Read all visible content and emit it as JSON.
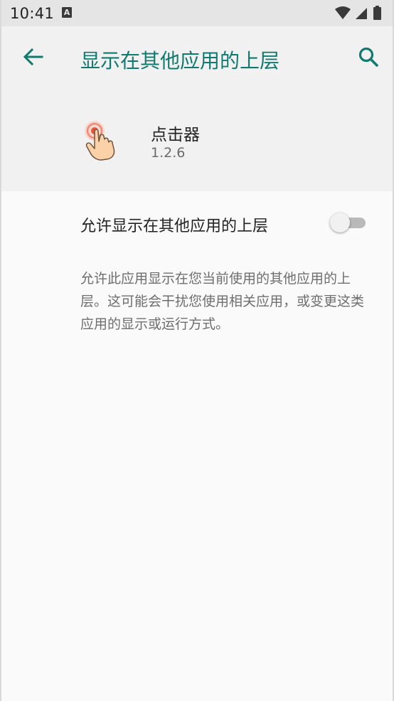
{
  "status_bar": {
    "time": "10:41",
    "notification_icon": "A",
    "icons": [
      "wifi-icon",
      "signal-icon",
      "battery-icon"
    ]
  },
  "header": {
    "title": "显示在其他应用的上层",
    "back_icon": "arrow-left-icon",
    "search_icon": "search-icon"
  },
  "app": {
    "name": "点击器",
    "version": "1.2.6",
    "icon": "tap-hand-icon"
  },
  "setting": {
    "label": "允许显示在其他应用的上层",
    "enabled": false
  },
  "description": "允许此应用显示在您当前使用的其他应用的上层。这可能会干扰您使用相关应用，或变更这类应用的显示或运行方式。",
  "colors": {
    "accent": "#117a6e",
    "header_bg": "#f1f1f1",
    "page_bg": "#fafafa",
    "status_bg": "#e5e5e5"
  }
}
